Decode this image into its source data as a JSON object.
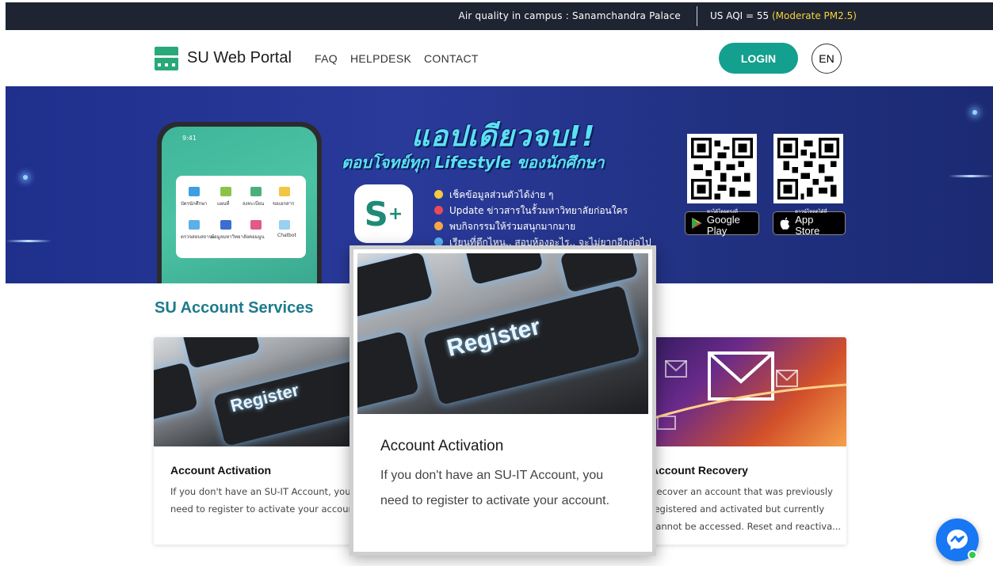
{
  "topbar": {
    "air_quality_label": "Air quality in campus : Sanamchandra Palace",
    "aqi_prefix": "US AQI = 55",
    "aqi_status": "(Moderate PM2.5)",
    "aqi_value": 55,
    "status_color": "#f6d43b"
  },
  "nav": {
    "brand": "SU Web Portal",
    "links": [
      "FAQ",
      "HELPDESK",
      "CONTACT"
    ],
    "login_label": "LOGIN",
    "lang_label": "EN",
    "accent_color": "#14a08e"
  },
  "banner": {
    "headline": "แอปเดียวจบ!!",
    "subheadline": "ตอบโจทย์ทุก Lifestyle ของนักศึกษา",
    "features": [
      "เช็คข้อมูลส่วนตัวได้ง่าย ๆ",
      "Update ข่าวสารในรั้วมหาวิทยาลัยก่อนใคร",
      "พบกิจกรรมให้ร่วมสนุกมากมาย",
      "เรียนที่ตึกไหน.. สอบห้องอะไร.. จะไม่ยากอีกต่อไป"
    ],
    "phone_time": "9:41",
    "phone_apps": [
      "บัตรนักศึกษา",
      "แผนที่",
      "ลงทะเบียน",
      "ขอเอกสาร",
      "ตรวจสอบสถานะ",
      "ข้อมูลมหาวิทยาลัย",
      "คอมมูน",
      "Chatbot"
    ],
    "google_play_small": "หาได้โดยตรงที่",
    "google_play_big": "Google Play",
    "app_store_small": "ดาวน์โหลดได้ที่",
    "app_store_big": "App Store"
  },
  "section": {
    "title": "SU Account Services"
  },
  "cards": [
    {
      "title": "Account Activation",
      "desc_line1": "If you don't have an SU-IT Account, you",
      "desc_line2": "need to register to activate your account.",
      "key_text": "Register"
    },
    {
      "title": "Account Recovery",
      "desc_line1": "Recover an account that was previously",
      "desc_line2": "registered and activated but currently",
      "desc_line3": "cannot be accessed. Reset and reactiva..."
    }
  ],
  "popup": {
    "title": "Account Activation",
    "desc_line1": "If you don't have an SU-IT Account, you",
    "desc_line2": "need to register to activate your account.",
    "key_text": "Register"
  }
}
